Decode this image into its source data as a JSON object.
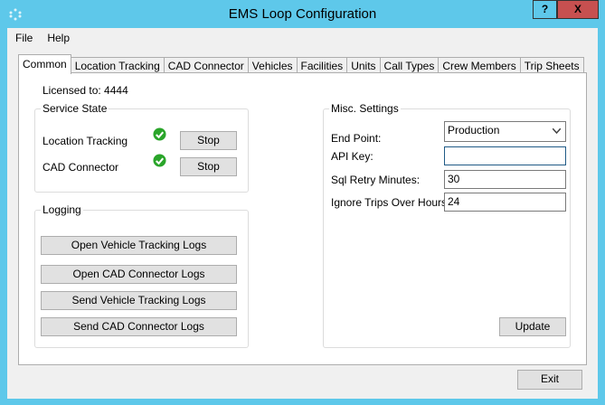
{
  "window": {
    "title": "EMS Loop Configuration",
    "help": "?",
    "close": "X"
  },
  "menu": [
    "File",
    "Help"
  ],
  "tabs": [
    "Common",
    "Location Tracking",
    "CAD Connector",
    "Vehicles",
    "Facilities",
    "Units",
    "Call Types",
    "Crew Members",
    "Trip Sheets"
  ],
  "common": {
    "licensed": "Licensed to: 4444",
    "service_state": {
      "title": "Service State",
      "rows": [
        {
          "label": "Location Tracking",
          "status": "running",
          "button": "Stop"
        },
        {
          "label": "CAD Connector",
          "status": "running",
          "button": "Stop"
        }
      ]
    },
    "logging": {
      "title": "Logging",
      "buttons": [
        "Open Vehicle Tracking Logs",
        "Open CAD Connector Logs",
        "Send Vehicle Tracking Logs",
        "Send CAD Connector Logs"
      ]
    },
    "misc": {
      "title": "Misc. Settings",
      "end_point_label": "End Point:",
      "end_point": "Production",
      "api_key_label": "API Key:",
      "api_key": "",
      "sql_retry_label": "Sql Retry Minutes:",
      "sql_retry": "30",
      "ignore_trips_label": "Ignore Trips Over Hours:",
      "ignore_trips": "24",
      "update": "Update"
    }
  },
  "footer": {
    "exit": "Exit"
  },
  "colors": {
    "titlebar": "#5ec8ea",
    "close": "#c75050",
    "check": "#2aa52a"
  }
}
